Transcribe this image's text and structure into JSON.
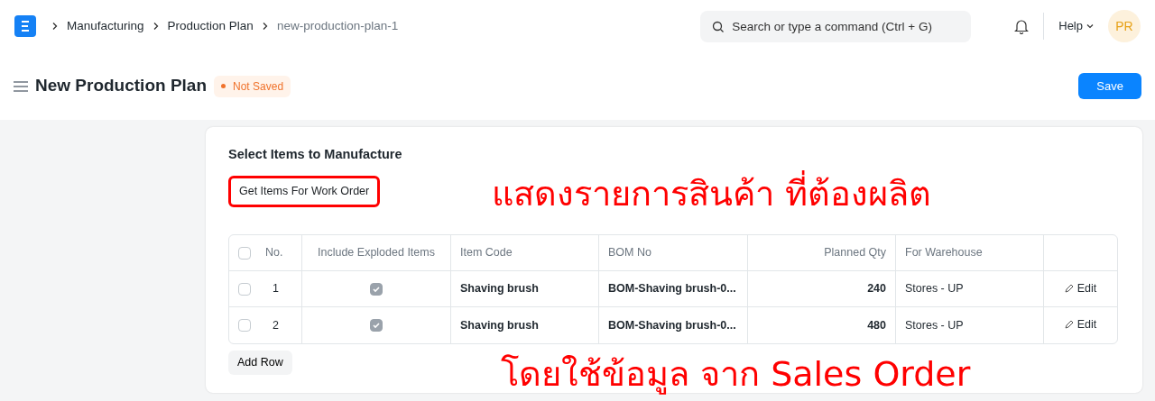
{
  "navbar": {
    "breadcrumbs": [
      {
        "label": "Manufacturing",
        "current": false
      },
      {
        "label": "Production Plan",
        "current": false
      },
      {
        "label": "new-production-plan-1",
        "current": true
      }
    ],
    "search": {
      "placeholder": "Search or type a command (Ctrl + G)"
    },
    "help": "Help",
    "avatar": "PR"
  },
  "page": {
    "title": "New Production Plan",
    "status": "Not Saved",
    "save": "Save"
  },
  "section": {
    "title": "Select Items to Manufacture",
    "get_items": {
      "label": "Get Items For Work Order",
      "highlighted": true
    },
    "table": {
      "select_all": false,
      "columns": [
        "No.",
        "Include Exploded Items",
        "Item Code",
        "BOM No",
        "Planned Qty",
        "For Warehouse"
      ],
      "rows": [
        {
          "selected": false,
          "no": "1",
          "include_exploded": true,
          "item_code": "Shaving brush",
          "bom_no": "BOM-Shaving brush-0...",
          "planned_qty": "240",
          "warehouse": "Stores - UP",
          "edit": "Edit"
        },
        {
          "selected": false,
          "no": "2",
          "include_exploded": true,
          "item_code": "Shaving brush",
          "bom_no": "BOM-Shaving brush-0...",
          "planned_qty": "480",
          "warehouse": "Stores - UP",
          "edit": "Edit"
        }
      ]
    },
    "add_row": "Add Row"
  },
  "annotations": [
    "แสดงรายการสินค้า ที่ต้องผลิต",
    "โดยใช้ข้อมูล จาก Sales Order"
  ]
}
